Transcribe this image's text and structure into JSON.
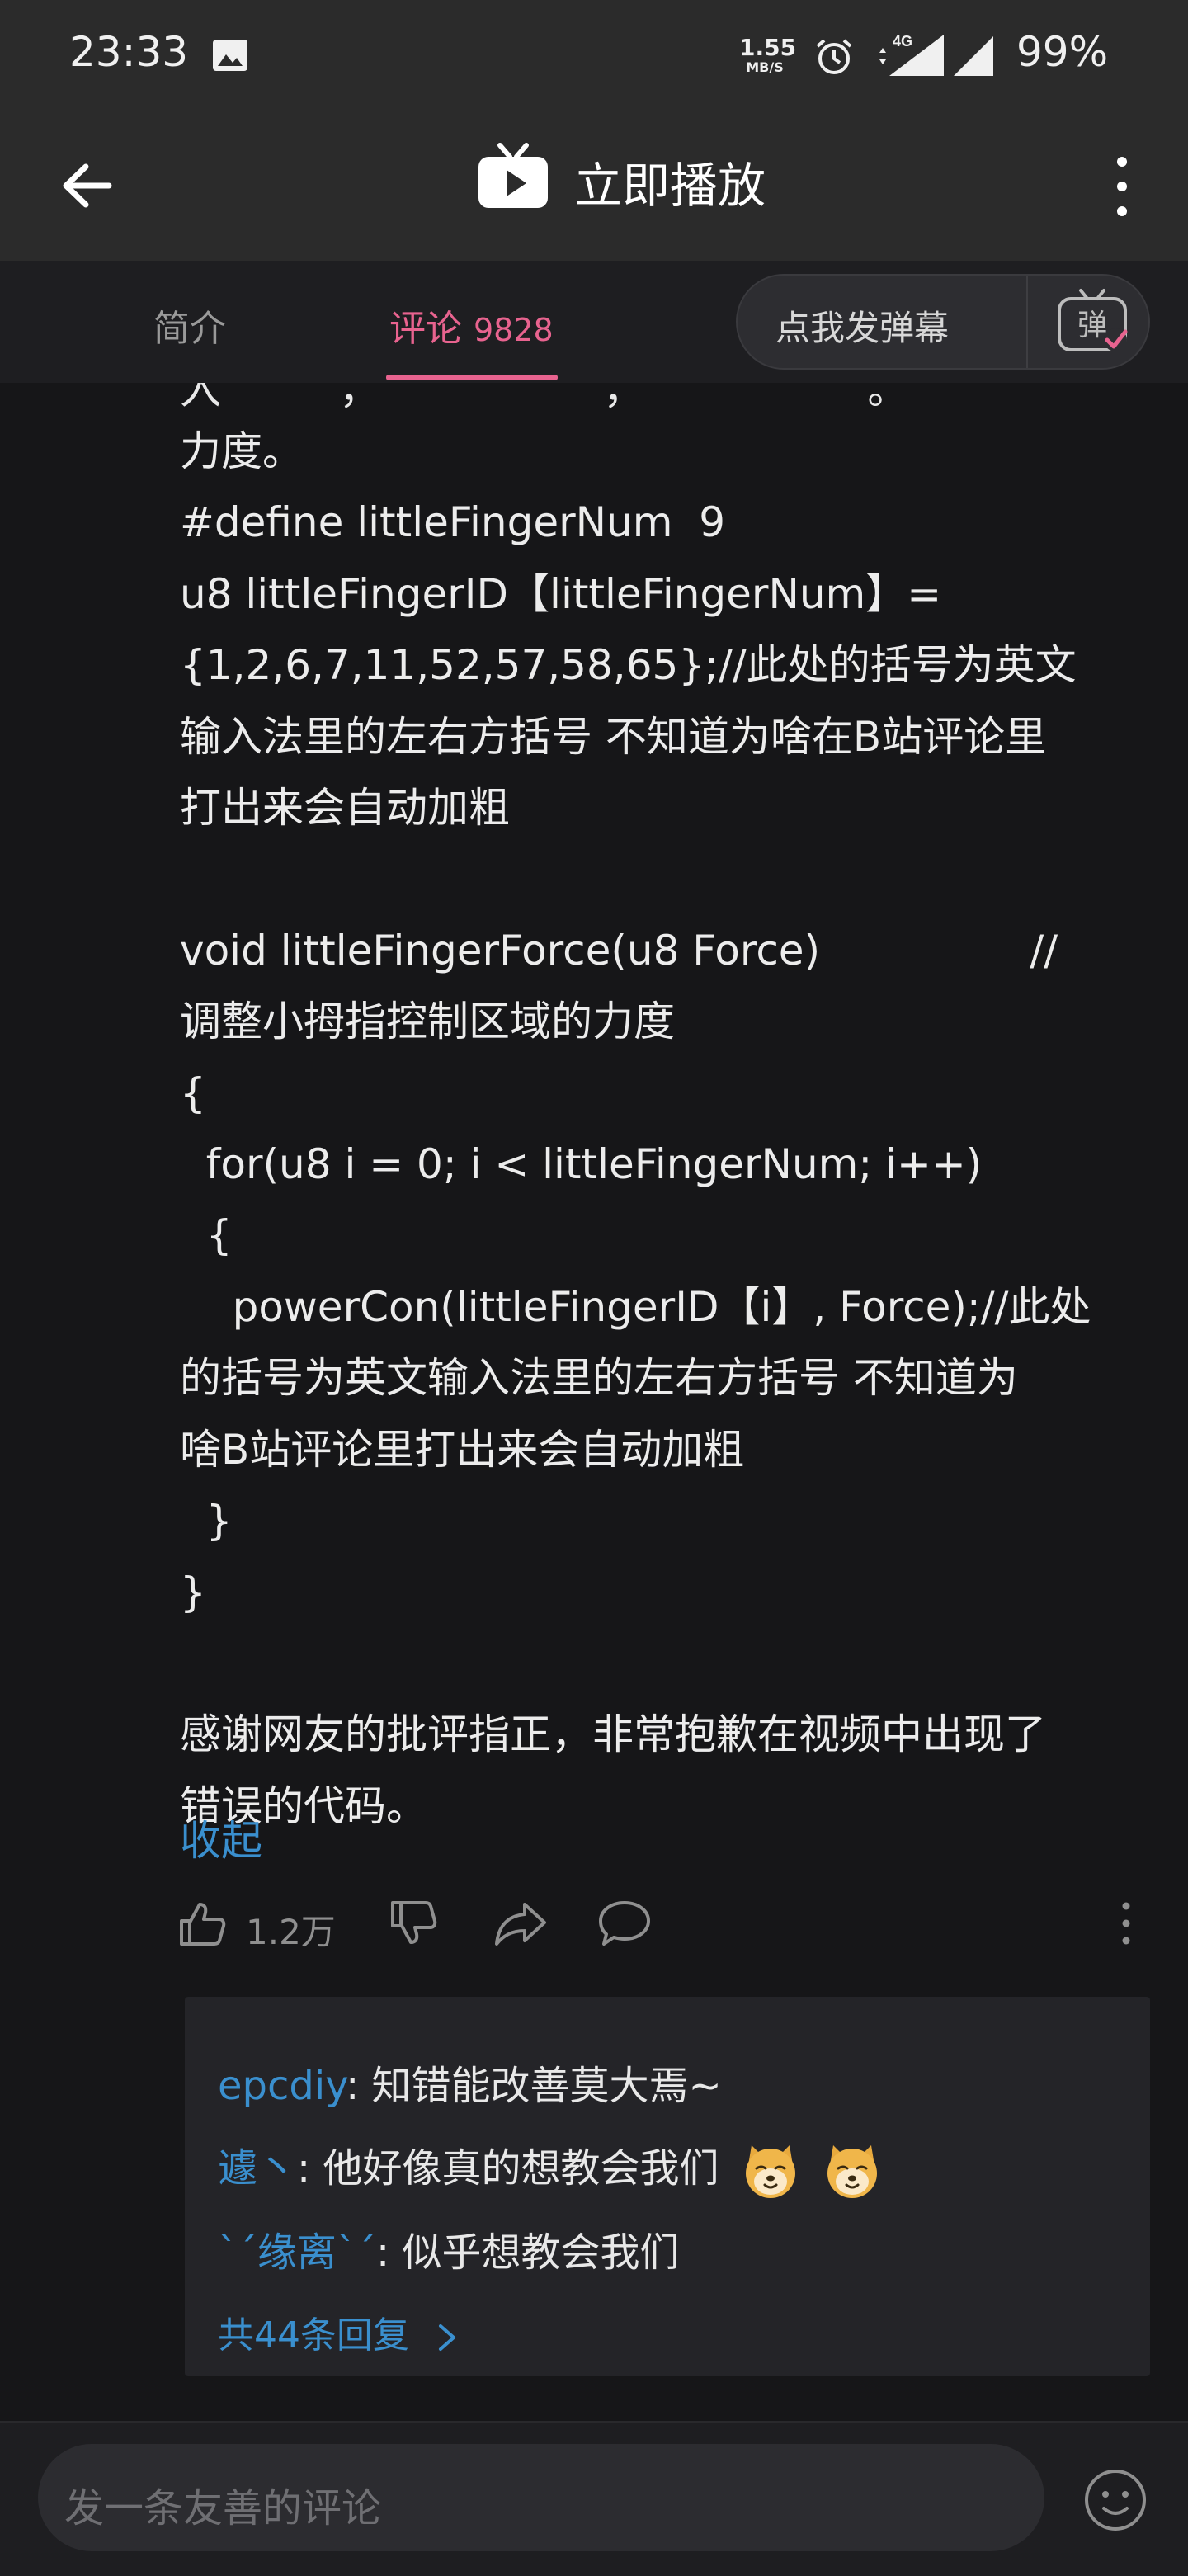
{
  "status_bar": {
    "time": "23:33",
    "net_speed_value": "1.55",
    "net_speed_unit": "MB/S",
    "network_type": "4G",
    "battery": "99%"
  },
  "app_bar": {
    "title": "立即播放"
  },
  "tabs": {
    "intro": "简介",
    "comments_label": "评论",
    "comments_count": "9828",
    "danmaku_prompt": "点我发弹幕",
    "danmaku_icon_char": "弹"
  },
  "comment": {
    "clipped_top_line": "入         ，                 ，                 。",
    "body": "力度。\n#define littleFingerNum  9\nu8 littleFingerID【littleFingerNum】=\n{1,2,6,7,11,52,57,58,65};//此处的括号为英文\n输入法里的左右方括号 不知道为啥在B站评论里\n打出来会自动加粗\n\nvoid littleFingerForce(u8 Force)                //\n调整小拇指控制区域的力度\n{\n  for(u8 i = 0; i < littleFingerNum; i++)\n  {\n    powerCon(littleFingerID【i】, Force);//此处\n的括号为英文输入法里的左右方括号 不知道为\n啥B站评论里打出来会自动加粗\n  }\n}\n\n感谢网友的批评指正，非常抱歉在视频中出现了\n错误的代码。",
    "collapse_label": "收起",
    "like_count": "1.2万"
  },
  "replies": {
    "items": [
      {
        "user": "epcdiy",
        "text": ": 知错能改善莫大焉~"
      },
      {
        "user": "遽丶",
        "text": ": 他好像真的想教会我们"
      },
      {
        "user": "ˋˊ缘离ˋˊ",
        "text": ": 似乎想教会我们"
      }
    ],
    "more_label": "共44条回复"
  },
  "bottom_bar": {
    "placeholder": "发一条友善的评论"
  },
  "colors": {
    "accent_pink": "#e8638f",
    "link_blue": "#3a8fce",
    "background": "#161618"
  }
}
